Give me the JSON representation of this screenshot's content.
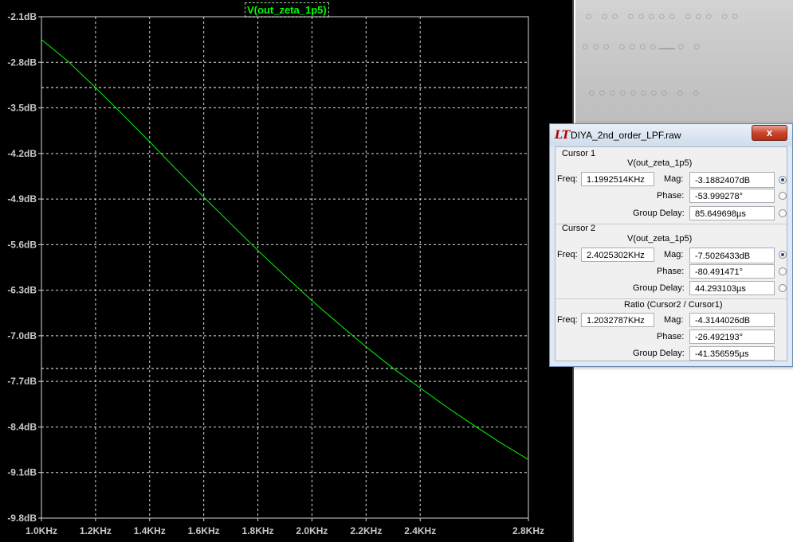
{
  "plot": {
    "trace_label": "V(out_zeta_1p5)",
    "trace_color": "#00ff00",
    "grid_color": "#d8d8d8",
    "background_color": "#000000"
  },
  "chart_data": {
    "type": "line",
    "x_scale": "log",
    "xlim": [
      1000,
      2800
    ],
    "ylim": [
      -9.8,
      -2.1
    ],
    "x_ticks": [
      {
        "value": 1000,
        "label": "1.0KHz"
      },
      {
        "value": 1200,
        "label": "1.2KHz"
      },
      {
        "value": 1400,
        "label": "1.4KHz"
      },
      {
        "value": 1600,
        "label": "1.6KHz"
      },
      {
        "value": 1800,
        "label": "1.8KHz"
      },
      {
        "value": 2000,
        "label": "2.0KHz"
      },
      {
        "value": 2200,
        "label": "2.2KHz"
      },
      {
        "value": 2400,
        "label": "2.4KHz"
      },
      {
        "value": 2800,
        "label": "2.8KHz"
      }
    ],
    "y_ticks": [
      {
        "value": -2.1,
        "label": "-2.1dB"
      },
      {
        "value": -2.8,
        "label": "-2.8dB"
      },
      {
        "value": -3.5,
        "label": "-3.5dB"
      },
      {
        "value": -4.2,
        "label": "-4.2dB"
      },
      {
        "value": -4.9,
        "label": "-4.9dB"
      },
      {
        "value": -5.6,
        "label": "-5.6dB"
      },
      {
        "value": -6.3,
        "label": "-6.3dB"
      },
      {
        "value": -7.0,
        "label": "-7.0dB"
      },
      {
        "value": -7.7,
        "label": "-7.7dB"
      },
      {
        "value": -8.4,
        "label": "-8.4dB"
      },
      {
        "value": -9.1,
        "label": "-9.1dB"
      },
      {
        "value": -9.8,
        "label": "-9.8dB"
      }
    ],
    "grid": true,
    "series": [
      {
        "name": "V(out_zeta_1p5)",
        "x": [
          1000,
          1100,
          1200,
          1300,
          1400,
          1500,
          1600,
          1700,
          1800,
          1900,
          2000,
          2100,
          2200,
          2300,
          2400,
          2500,
          2600,
          2700,
          2800
        ],
        "y": [
          -2.45,
          -2.79,
          -3.19,
          -3.6,
          -4.02,
          -4.45,
          -4.87,
          -5.28,
          -5.69,
          -6.08,
          -6.46,
          -6.82,
          -7.17,
          -7.5,
          -7.8,
          -8.1,
          -8.38,
          -8.65,
          -8.9
        ]
      }
    ],
    "cursors": [
      {
        "x": 1199.2514,
        "y": -3.1882407
      },
      {
        "x": 2402.5302,
        "y": -7.5026433
      }
    ]
  },
  "dialog": {
    "title": "DIYA_2nd_order_LPF.raw",
    "logo": "LT",
    "close_label": "x",
    "cursor1": {
      "section_label": "Cursor 1",
      "trace": "V(out_zeta_1p5)",
      "freq_label": "Freq:",
      "freq": "1.1992514KHz",
      "mag_label": "Mag:",
      "mag": "-3.1882407dB",
      "phase_label": "Phase:",
      "phase": "-53.999278°",
      "gd_label": "Group Delay:",
      "gd": "85.649698µs"
    },
    "cursor2": {
      "section_label": "Cursor 2",
      "trace": "V(out_zeta_1p5)",
      "freq_label": "Freq:",
      "freq": "2.4025302KHz",
      "mag_label": "Mag:",
      "mag": "-7.5026433dB",
      "phase_label": "Phase:",
      "phase": "-80.491471°",
      "gd_label": "Group Delay:",
      "gd": "44.293103µs"
    },
    "ratio": {
      "section_label": "Ratio (Cursor2 / Cursor1)",
      "freq_label": "Freq:",
      "freq": "1.2032787KHz",
      "mag_label": "Mag:",
      "mag": "-4.3144026dB",
      "phase_label": "Phase:",
      "phase": "-26.492193°",
      "gd_label": "Group Delay:",
      "gd": "-41.356595µs"
    }
  }
}
